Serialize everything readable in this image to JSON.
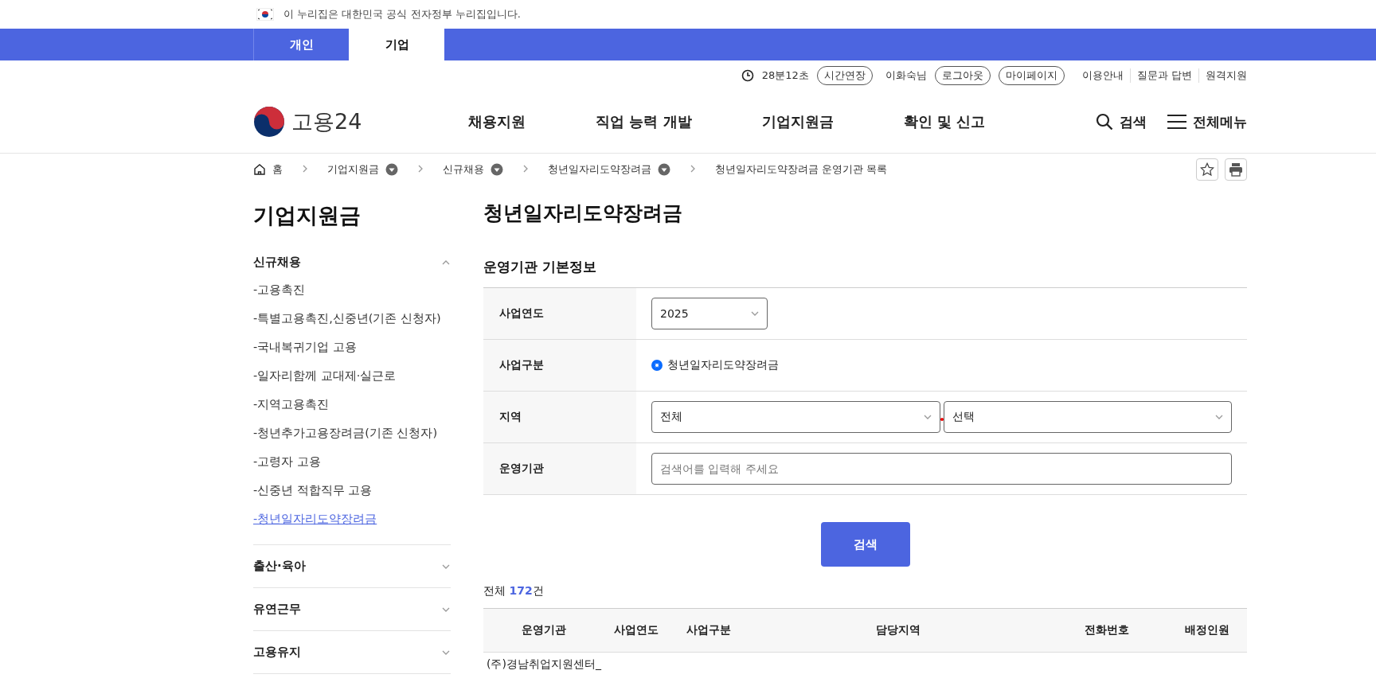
{
  "gov_banner": {
    "text": "이 누리집은 대한민국 공식 전자정부 누리집입니다."
  },
  "audience_tabs": [
    {
      "label": "개인",
      "selected": false
    },
    {
      "label": "기업",
      "selected": true
    }
  ],
  "utility": {
    "timer": "28분12초",
    "extend_button": "시간연장",
    "user": "이화숙님",
    "logout_button": "로그아웃",
    "mypage_button": "마이페이지",
    "links": [
      "이용안내",
      "질문과 답변",
      "원격지원"
    ]
  },
  "logo": {
    "text": "고용24"
  },
  "main_nav": [
    "채용지원",
    "직업 능력 개발",
    "기업지원금",
    "확인 및 신고"
  ],
  "header_actions": {
    "search": "검색",
    "menu": "전체메뉴"
  },
  "breadcrumb": [
    {
      "label": "홈",
      "kind": "home"
    },
    {
      "label": "기업지원금",
      "kind": "dropdown"
    },
    {
      "label": "신규채용",
      "kind": "dropdown"
    },
    {
      "label": "청년일자리도약장려금",
      "kind": "dropdown"
    },
    {
      "label": "청년일자리도약장려금 운영기관 목록",
      "kind": "current"
    }
  ],
  "sidebar": {
    "title": "기업지원금",
    "groups": [
      {
        "label": "신규채용",
        "expanded": true,
        "children": [
          {
            "label": "-고용촉진",
            "selected": false
          },
          {
            "label": "-특별고용촉진,신중년(기존 신청자)",
            "selected": false
          },
          {
            "label": "-국내복귀기업 고용",
            "selected": false
          },
          {
            "label": "-일자리함께 교대제·실근로",
            "selected": false
          },
          {
            "label": "-지역고용촉진",
            "selected": false
          },
          {
            "label": "-청년추가고용장려금(기존 신청자)",
            "selected": false
          },
          {
            "label": "-고령자 고용",
            "selected": false
          },
          {
            "label": "-신중년 적합직무 고용",
            "selected": false
          },
          {
            "label": "-청년일자리도약장려금",
            "selected": true
          }
        ]
      },
      {
        "label": "출산·육아",
        "expanded": false
      },
      {
        "label": "유연근무",
        "expanded": false
      },
      {
        "label": "고용유지",
        "expanded": false
      }
    ]
  },
  "page_title": "청년일자리도약장려금",
  "section_title": "운영기관 기본정보",
  "form_rows": [
    {
      "label": "사업연도",
      "kind": "select",
      "value": "2025"
    },
    {
      "label": "사업구분",
      "kind": "radio",
      "options": [
        {
          "label": "청년일자리도약장려금",
          "checked": true
        }
      ]
    },
    {
      "label": "지역",
      "kind": "select_pair",
      "values": [
        "전체",
        "선택"
      ]
    },
    {
      "label": "운영기관",
      "kind": "text",
      "placeholder": "검색어를 입력해 주세요"
    }
  ],
  "search_button": "검색",
  "result_count": "전체 **172**건",
  "table": {
    "columns": [
      "운영기관",
      "사업연도",
      "사업구분",
      "담당지역",
      "전화번호",
      "배정인원"
    ],
    "rows": [
      [
        "(주)경남취업지원센터_"
      ]
    ]
  }
}
